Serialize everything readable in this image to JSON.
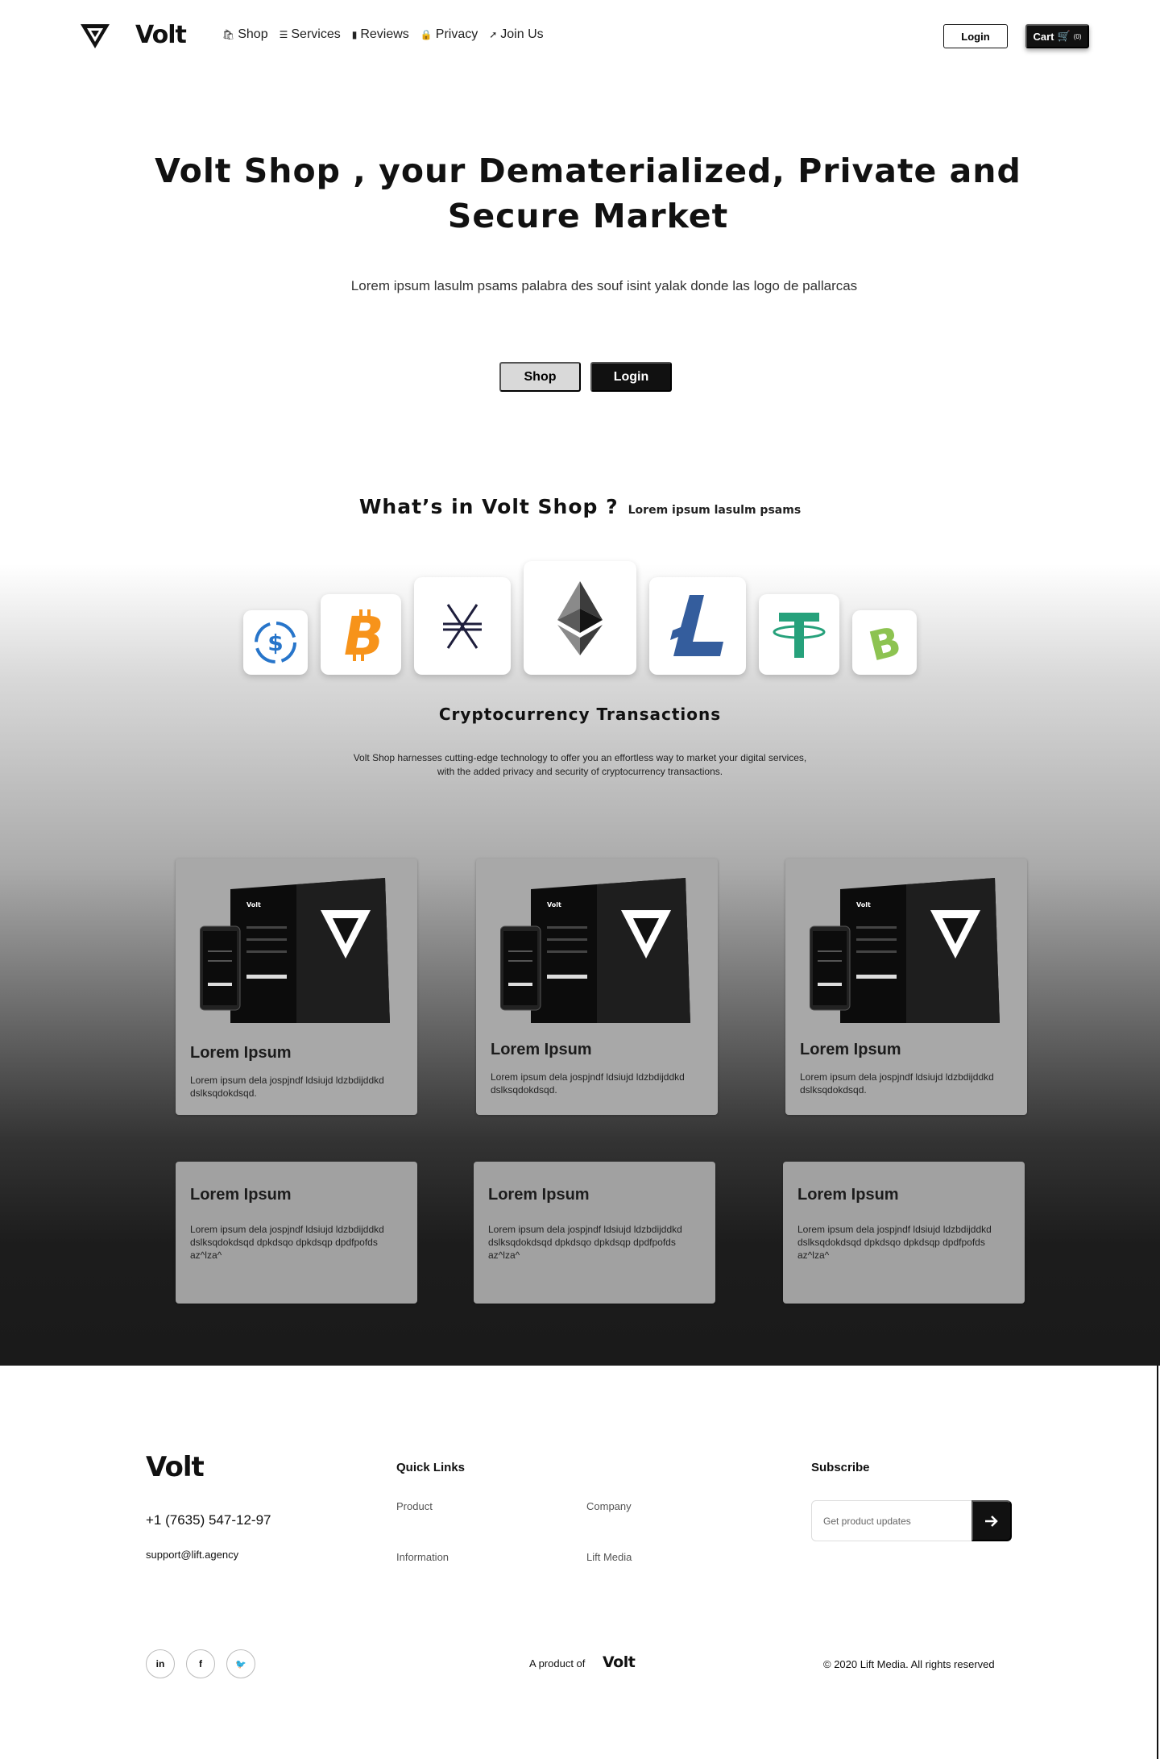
{
  "header": {
    "logo_text": "Volt",
    "nav": [
      {
        "icon": "bag-icon",
        "glyph": "🛍",
        "label": "Shop"
      },
      {
        "icon": "list-icon",
        "glyph": "☰",
        "label": "Services"
      },
      {
        "icon": "comment-icon",
        "glyph": "▮",
        "label": "Reviews"
      },
      {
        "icon": "lock-icon",
        "glyph": "🔒",
        "label": "Privacy"
      },
      {
        "icon": "arrow-icon",
        "glyph": "➚",
        "label": "Join Us"
      }
    ],
    "login_label": "Login",
    "cart_label": "Cart",
    "cart_count": "(0)"
  },
  "hero": {
    "title": "Volt Shop , your Dematerialized, Private and Secure Market",
    "subtitle": "Lorem ipsum lasulm psams palabra des souf isint yalak donde las logo de pallarcas",
    "shop_label": "Shop",
    "login_label": "Login"
  },
  "section": {
    "heading": "What’s in Volt Shop ?",
    "subheading": "Lorem ipsum lasulm psams",
    "coins": [
      "usdc-icon",
      "bitcoin-icon",
      "stellar-icon",
      "ethereum-icon",
      "litecoin-icon",
      "tether-icon",
      "bitcoin-cash-icon"
    ],
    "crypto_title": "Cryptocurrency Transactions",
    "crypto_desc": "Volt Shop harnesses cutting-edge technology to offer you an effortless way to market your digital services, with the added privacy and security of cryptocurrency transactions."
  },
  "cards_top": [
    {
      "title": "Lorem Ipsum",
      "body": "Lorem ipsum dela jospjndf ldsiujd ldzbdijddkd dslksqdokdsqd."
    },
    {
      "title": "Lorem Ipsum",
      "body": "Lorem ipsum dela jospjndf ldsiujd ldzbdijddkd dslksqdokdsqd."
    },
    {
      "title": "Lorem Ipsum",
      "body": "Lorem ipsum dela jospjndf ldsiujd ldzbdijddkd dslksqdokdsqd."
    }
  ],
  "cards_bottom": [
    {
      "title": "Lorem Ipsum",
      "body": "Lorem ipsum dela jospjndf ldsiujd ldzbdijddkd dslksqdokdsqd  dpkdsqo dpkdsqp dpdfpofds az^lza^"
    },
    {
      "title": "Lorem Ipsum",
      "body": "Lorem ipsum dela jospjndf ldsiujd ldzbdijddkd dslksqdokdsqd  dpkdsqo dpkdsqp dpdfpofds az^lza^"
    },
    {
      "title": "Lorem Ipsum",
      "body": "Lorem ipsum dela jospjndf ldsiujd ldzbdijddkd dslksqdokdsqd  dpkdsqo dpkdsqp dpdfpofds az^lza^"
    }
  ],
  "mockup": {
    "brand": "Volt"
  },
  "footer": {
    "logo_text": "Volt",
    "phone": "+1 (7635) 547-12-97",
    "email": "support@lift.agency",
    "quick_links_title": "Quick Links",
    "links": [
      "Product",
      "Company",
      "Information",
      "Lift Media"
    ],
    "subscribe_title": "Subscribe",
    "subscribe_placeholder": "Get product updates",
    "social": [
      {
        "icon": "linkedin-icon",
        "glyph": "in"
      },
      {
        "icon": "facebook-icon",
        "glyph": "f"
      },
      {
        "icon": "twitter-icon",
        "glyph": "🐦"
      }
    ],
    "product_of": "A product of",
    "product_logo": "Volt",
    "copyright": "© 2020 Lift Media. All rights reserved"
  },
  "colors": {
    "primary": "#111111",
    "bitcoin": "#F7931A",
    "usdc": "#2775CA",
    "litecoin": "#345D9D",
    "tether": "#26A17B",
    "bitcoin_cash": "#8DC351",
    "stellar": "#1E1E3C"
  }
}
